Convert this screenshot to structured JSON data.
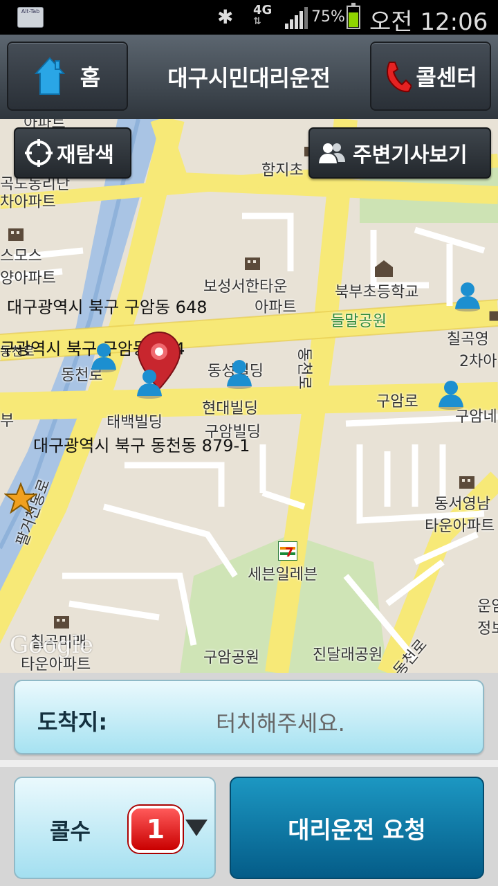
{
  "status_bar": {
    "app_icon_label": "Alt-Tab",
    "network": "4G",
    "battery_percent": "75%",
    "battery_level": 0.75,
    "time": "오전 12:06"
  },
  "header": {
    "home_label": "홈",
    "title": "대구시민대리운전",
    "call_center_label": "콜센터"
  },
  "map": {
    "rescan_label": "재탐색",
    "nearby_drivers_label": "주변기사보기",
    "addresses": [
      "대구광역시 북구 구암동 648",
      "구광역시 북구 구암동 654",
      "대구광역시 북구 동천동 879-1"
    ],
    "place_labels": [
      "아파트",
      "함지초",
      "곡도동리단",
      "차아파트",
      "스모스",
      "양아파트",
      "보성서한타운",
      "아파트",
      "북부초등학교",
      "들말공원",
      "칠곡영",
      "2차아",
      "동천로",
      "동성빌딩",
      "현대빌딩",
      "구암빌딩",
      "구암로",
      "구암네",
      "태백빌딩",
      "동천로",
      "팔거천동로",
      "동서영남",
      "타운아파트",
      "세븐일레븐",
      "칠곡미래",
      "타운아파트",
      "구암공원",
      "진달래공원",
      "운암",
      "정보",
      "동천로",
      "부",
      "동천로"
    ],
    "google_watermark": "Google"
  },
  "destination": {
    "label": "도착지:",
    "placeholder": "터치해주세요."
  },
  "call_count": {
    "label": "콜수",
    "value": "1"
  },
  "request_button": {
    "label": "대리운전 요청"
  }
}
